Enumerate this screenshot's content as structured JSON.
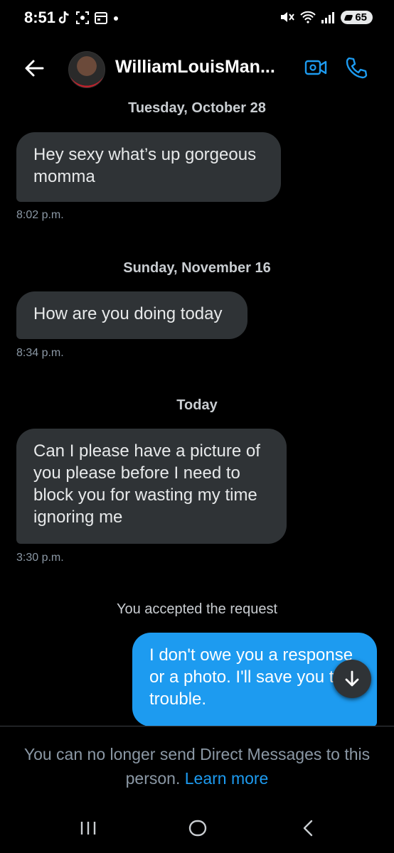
{
  "status": {
    "time": "8:51",
    "battery": "65"
  },
  "header": {
    "contact_name": "WilliamLouisMan..."
  },
  "conversation": [
    {
      "type": "date",
      "text": "Tuesday, October 28"
    },
    {
      "type": "incoming",
      "text": "Hey sexy what’s up gorgeous momma",
      "time": "8:02 p.m."
    },
    {
      "type": "date",
      "text": "Sunday, November 16"
    },
    {
      "type": "incoming",
      "text": "How are you doing today",
      "time": "8:34 p.m."
    },
    {
      "type": "date",
      "text": "Today"
    },
    {
      "type": "incoming",
      "text": "Can I please have a picture of you please before I need to block you for wasting my time ignoring me",
      "time": "3:30 p.m."
    },
    {
      "type": "system",
      "text": "You accepted the request"
    },
    {
      "type": "outgoing",
      "text": "I don't owe you a response or a photo. I'll save you the trouble."
    }
  ],
  "footer": {
    "notice": "You can no longer send Direct Messages to this person.",
    "learn_more": "Learn more"
  },
  "colors": {
    "background": "#000000",
    "incoming_bubble": "#2f3336",
    "outgoing_bubble": "#1d9bf0",
    "link": "#1d9bf0"
  },
  "icons": [
    "back-arrow-icon",
    "video-call-icon",
    "phone-icon",
    "arrow-down-icon",
    "recent-apps-icon",
    "home-icon",
    "nav-back-icon"
  ]
}
